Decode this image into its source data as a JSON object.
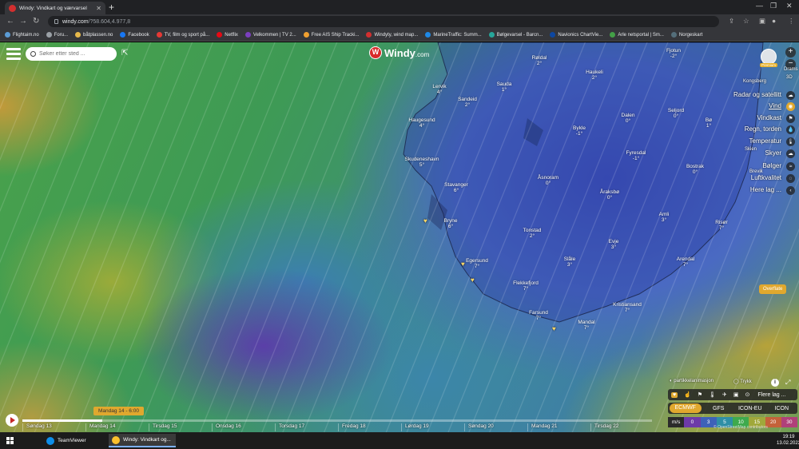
{
  "browser": {
    "tab_title": "Windy: Vindkart og værvarsel",
    "url_host": "windy.com",
    "url_path": "/?58.604,4.977,8",
    "bookmarks": [
      {
        "label": "Flightaim.no",
        "color": "#5b9bd5"
      },
      {
        "label": "Foru...",
        "color": "#9aa0a6"
      },
      {
        "label": "båtplassen.no",
        "color": "#e6b84a"
      },
      {
        "label": "Facebook",
        "color": "#1877f2"
      },
      {
        "label": "TV, film og sport på...",
        "color": "#e53935"
      },
      {
        "label": "Netflix",
        "color": "#e50914"
      },
      {
        "label": "Velkommen | TV 2...",
        "color": "#7b3fbf"
      },
      {
        "label": "Free AIS Ship Tracki...",
        "color": "#f0a030"
      },
      {
        "label": "Windyty, wind map...",
        "color": "#d32f2f"
      },
      {
        "label": "MarineTraffic: Summ...",
        "color": "#1e88e5"
      },
      {
        "label": "Bølgevarsel - Barcn...",
        "color": "#26a69a"
      },
      {
        "label": "Navionics ChartVie...",
        "color": "#0d47a1"
      },
      {
        "label": "Arle netsportal | Sm...",
        "color": "#43a047"
      },
      {
        "label": "Norgeskart",
        "color": "#546e7a"
      }
    ]
  },
  "windy": {
    "logo_text": "Windy",
    "logo_suffix": ".com",
    "search_placeholder": "Søker etter sted ...",
    "premium_badge": "Premium",
    "drama_label": "Drams",
    "view_3d": "3D",
    "layers": [
      {
        "label": "Radar og satellitt",
        "active": false
      },
      {
        "label": "Vind",
        "active": true
      },
      {
        "label": "Vindkast",
        "active": false
      },
      {
        "label": "Regn, torden",
        "active": false
      },
      {
        "label": "Temperatur",
        "active": false
      },
      {
        "label": "Skyer",
        "active": false
      },
      {
        "label": "Bølger",
        "active": false
      },
      {
        "label": "Luftkvalitet",
        "active": false
      },
      {
        "label": "Flere lag ...",
        "active": false
      }
    ],
    "overlay_extra_1": "Kongsberg",
    "overlay_extra_2": "Skien",
    "overlay_extra_3": "Brevik",
    "surface_button": "Overflate",
    "particles_label": "partikkelanimasjon",
    "pressure_label": "Trykk",
    "more_layers": "Flere lag ...",
    "models": [
      {
        "label": "ECMWF",
        "selected": true
      },
      {
        "label": "GFS",
        "selected": false
      },
      {
        "label": "ICON-EU",
        "selected": false
      },
      {
        "label": "ICON",
        "selected": false
      }
    ],
    "legend_unit": "m/s",
    "legend_values": [
      "0",
      "3",
      "5",
      "10",
      "15",
      "20",
      "30"
    ],
    "legend_colors": [
      "#6d3aa8",
      "#3e62b8",
      "#2f8fa6",
      "#3eaa4d",
      "#a0a83a",
      "#c4623a",
      "#b0407a"
    ],
    "attribution": "© OpenStreetMap contributors",
    "timeline": {
      "current": "Mandag 14 - 6:00",
      "days": [
        "Søndag 13",
        "Mandag 14",
        "Tirsdag 15",
        "Onsdag 16",
        "Torsdag 17",
        "Fredag 18",
        "Lørdag 19",
        "Søndag 20",
        "Mandag 21",
        "Tirsdag 22"
      ]
    },
    "cities": [
      {
        "name": "Fjotun",
        "temp": "-2°"
      },
      {
        "name": "Røldal",
        "temp": "2°"
      },
      {
        "name": "Haukeli",
        "temp": "2°"
      },
      {
        "name": "Sauda",
        "temp": "1°"
      },
      {
        "name": "Sandeid",
        "temp": "2°"
      },
      {
        "name": "Haugesund",
        "temp": "4°"
      },
      {
        "name": "Bykle",
        "temp": "-1°"
      },
      {
        "name": "Dalen",
        "temp": "0°"
      },
      {
        "name": "Seljord",
        "temp": "0°"
      },
      {
        "name": "Bø",
        "temp": "1°"
      },
      {
        "name": "Skudeneshavn",
        "temp": "5°"
      },
      {
        "name": "Fyresdal",
        "temp": "-1°"
      },
      {
        "name": "Åsnoram",
        "temp": "0°"
      },
      {
        "name": "Stavanger",
        "temp": "6°"
      },
      {
        "name": "Bostrak",
        "temp": "0°"
      },
      {
        "name": "Åraksbø",
        "temp": "0°"
      },
      {
        "name": "Bryne",
        "temp": "6°"
      },
      {
        "name": "Amli",
        "temp": "3°"
      },
      {
        "name": "Tonstad",
        "temp": "2°"
      },
      {
        "name": "Risør",
        "temp": "7°"
      },
      {
        "name": "Evje",
        "temp": "3°"
      },
      {
        "name": "Egersund",
        "temp": "7°"
      },
      {
        "name": "Slåle",
        "temp": "3°"
      },
      {
        "name": "Arendal",
        "temp": "7°"
      },
      {
        "name": "Flekkefjord",
        "temp": "7°"
      },
      {
        "name": "Kristiansand",
        "temp": "7°"
      },
      {
        "name": "Farsund",
        "temp": "7°"
      },
      {
        "name": "Mandal",
        "temp": "7°"
      },
      {
        "name": "Lervik",
        "temp": "4°"
      }
    ]
  },
  "taskbar": {
    "items": [
      {
        "label": "TeamViewer",
        "color": "#0e8ee9",
        "active": false
      },
      {
        "label": "Windy: Vindkart og...",
        "color": "#fbc02d",
        "active": true
      }
    ],
    "time": "19:19",
    "date": "13.02.2022"
  }
}
